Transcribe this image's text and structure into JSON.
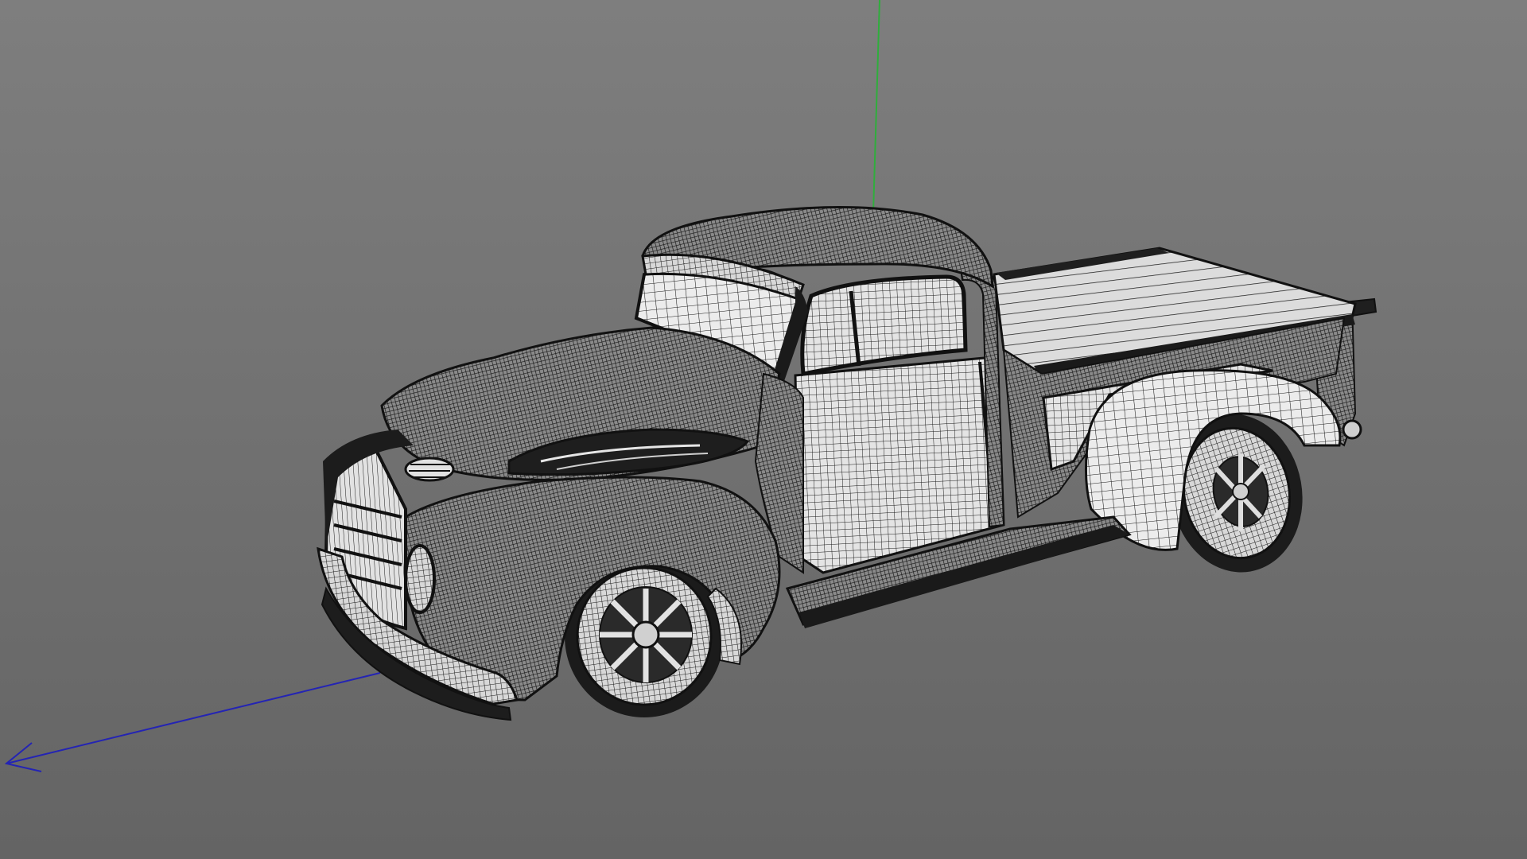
{
  "viewport": {
    "background_top": "#7e7e7e",
    "background_bottom": "#646464",
    "axis_y_color": "#2fae3c",
    "axis_z_color": "#2424b4",
    "wire_color": "#1b1b1b",
    "surface_light": "#e9e9e9",
    "surface_dark": "#2b2b2b",
    "model": "wireframe-pickup-truck"
  }
}
